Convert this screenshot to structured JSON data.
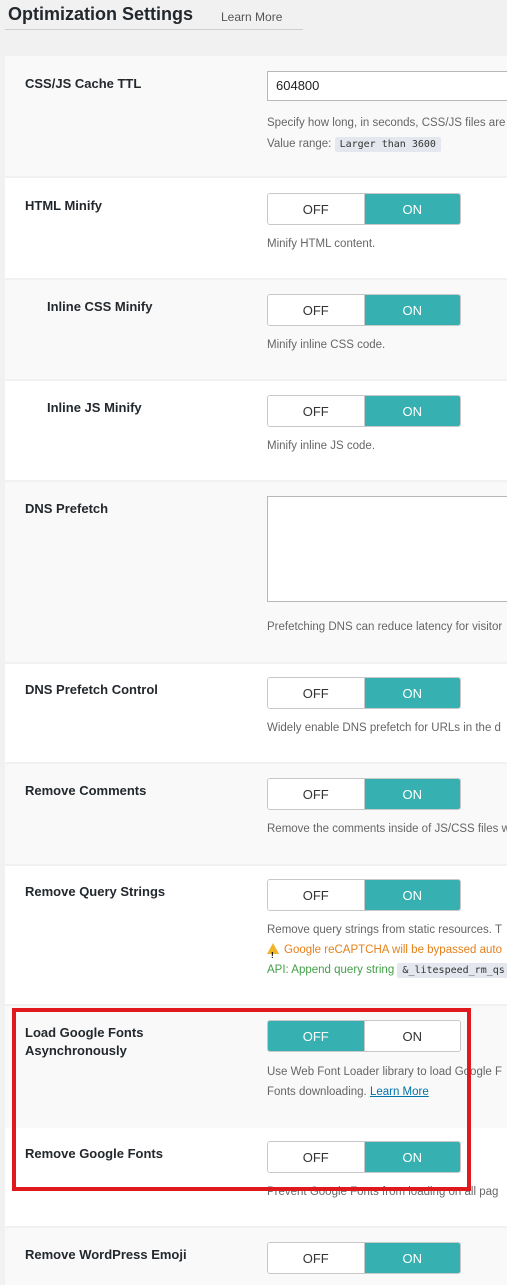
{
  "header": {
    "title": "Optimization Settings",
    "learn_more": "Learn More"
  },
  "settings": {
    "cache_ttl": {
      "label": "CSS/JS Cache TTL",
      "value": "604800",
      "desc1": "Specify how long, in seconds, CSS/JS files are",
      "desc2_prefix": "Value range:",
      "desc2_code": "Larger than 3600"
    },
    "html_minify": {
      "label": "HTML Minify",
      "off": "OFF",
      "on": "ON",
      "desc": "Minify HTML content."
    },
    "inline_css": {
      "label": "Inline CSS Minify",
      "off": "OFF",
      "on": "ON",
      "desc": "Minify inline CSS code."
    },
    "inline_js": {
      "label": "Inline JS Minify",
      "off": "OFF",
      "on": "ON",
      "desc": "Minify inline JS code."
    },
    "dns_prefetch": {
      "label": "DNS Prefetch",
      "value": "",
      "desc": "Prefetching DNS can reduce latency for visitor"
    },
    "dns_prefetch_control": {
      "label": "DNS Prefetch Control",
      "off": "OFF",
      "on": "ON",
      "desc": "Widely enable DNS prefetch for URLs in the d"
    },
    "remove_comments": {
      "label": "Remove Comments",
      "off": "OFF",
      "on": "ON",
      "desc": "Remove the comments inside of JS/CSS files w"
    },
    "remove_query": {
      "label": "Remove Query Strings",
      "off": "OFF",
      "on": "ON",
      "desc": "Remove query strings from static resources. T",
      "warning": "Google reCAPTCHA will be bypassed auto",
      "api_prefix": "API: Append query string",
      "api_code": "&_litespeed_rm_qs"
    },
    "google_fonts_async": {
      "label_line1": "Load Google Fonts",
      "label_line2": "Asynchronously",
      "off": "OFF",
      "on": "ON",
      "desc1": "Use Web Font Loader library to load Google F",
      "desc2_prefix": "Fonts downloading.",
      "desc2_link": "Learn More"
    },
    "remove_google_fonts": {
      "label": "Remove Google Fonts",
      "off": "OFF",
      "on": "ON",
      "desc": "Prevent Google Fonts from loading on all pag"
    },
    "remove_emoji": {
      "label": "Remove WordPress Emoji",
      "off": "OFF",
      "on": "ON"
    }
  },
  "colors": {
    "accent": "#36b0b0",
    "highlight": "#e0191e",
    "warning": "#e6801a",
    "api": "#43a047"
  }
}
